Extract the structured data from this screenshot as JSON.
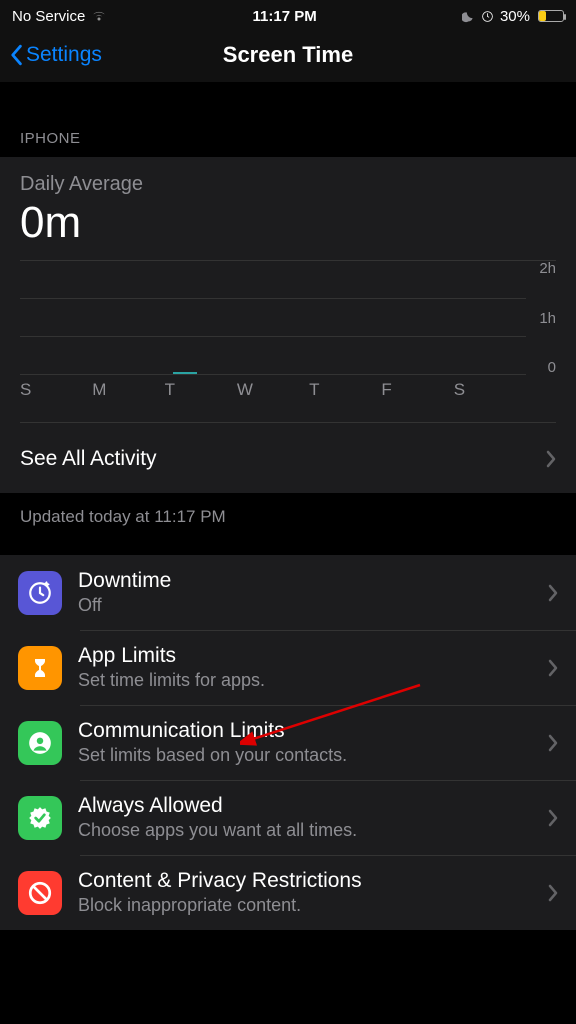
{
  "statusbar": {
    "carrier": "No Service",
    "time": "11:17 PM",
    "battery_pct": "30%"
  },
  "nav": {
    "back_label": "Settings",
    "title": "Screen Time"
  },
  "section_header": "IPHONE",
  "usage": {
    "daily_label": "Daily Average",
    "daily_value": "0m",
    "see_all": "See All Activity",
    "updated": "Updated today at 11:17 PM"
  },
  "chart_data": {
    "type": "bar",
    "categories": [
      "S",
      "M",
      "T",
      "W",
      "T",
      "F",
      "S"
    ],
    "values": [
      0,
      0,
      0,
      0,
      0,
      0,
      0
    ],
    "ylim": [
      0,
      2
    ],
    "ylabels": [
      "2h",
      "1h",
      "0"
    ],
    "title": "Daily Average",
    "xlabel": "",
    "ylabel": "hours"
  },
  "rows": [
    {
      "id": "downtime",
      "title": "Downtime",
      "sub": "Off",
      "icon": "clock-sleep-icon",
      "color": "#5856d6"
    },
    {
      "id": "applimits",
      "title": "App Limits",
      "sub": "Set time limits for apps.",
      "icon": "hourglass-icon",
      "color": "#ff9500"
    },
    {
      "id": "comm",
      "title": "Communication Limits",
      "sub": "Set limits based on your contacts.",
      "icon": "contact-icon",
      "color": "#34c759"
    },
    {
      "id": "always",
      "title": "Always Allowed",
      "sub": "Choose apps you want at all times.",
      "icon": "check-badge-icon",
      "color": "#34c759"
    },
    {
      "id": "content",
      "title": "Content & Privacy Restrictions",
      "sub": "Block inappropriate content.",
      "icon": "nosign-icon",
      "color": "#ff3b30"
    }
  ]
}
